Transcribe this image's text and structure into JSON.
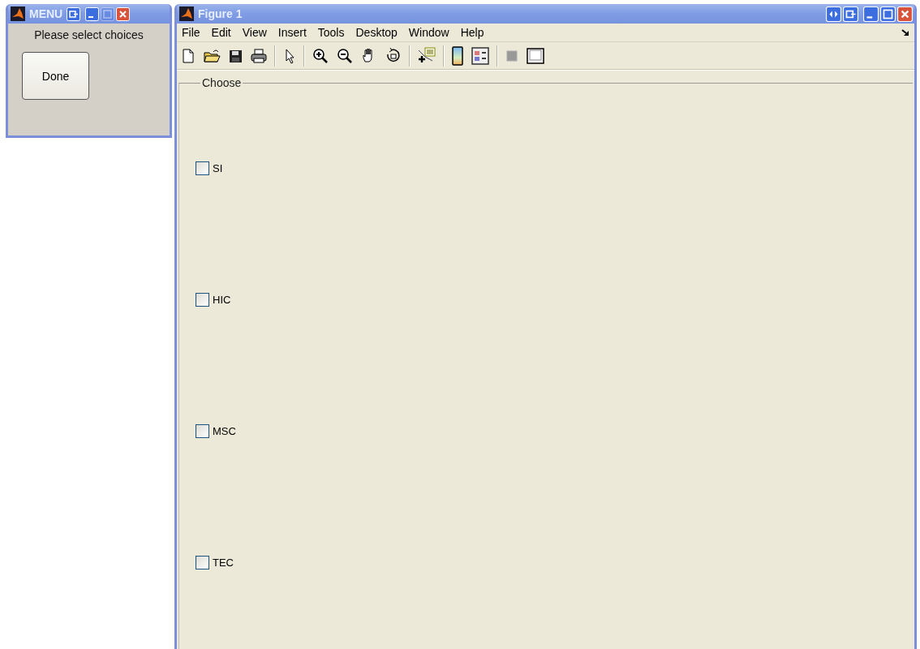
{
  "menu_window": {
    "title": "MENU",
    "maximize_disabled": true,
    "prompt": "Please select choices",
    "button": "Done"
  },
  "figure_window": {
    "title": "Figure 1",
    "menu_bar": [
      "File",
      "Edit",
      "View",
      "Insert",
      "Tools",
      "Desktop",
      "Window",
      "Help"
    ],
    "panel": {
      "title": "Choose",
      "checkboxes": [
        {
          "label": "SI",
          "checked": false
        },
        {
          "label": "HIC",
          "checked": false
        },
        {
          "label": "MSC",
          "checked": false
        },
        {
          "label": "TEC",
          "checked": false
        }
      ]
    }
  }
}
